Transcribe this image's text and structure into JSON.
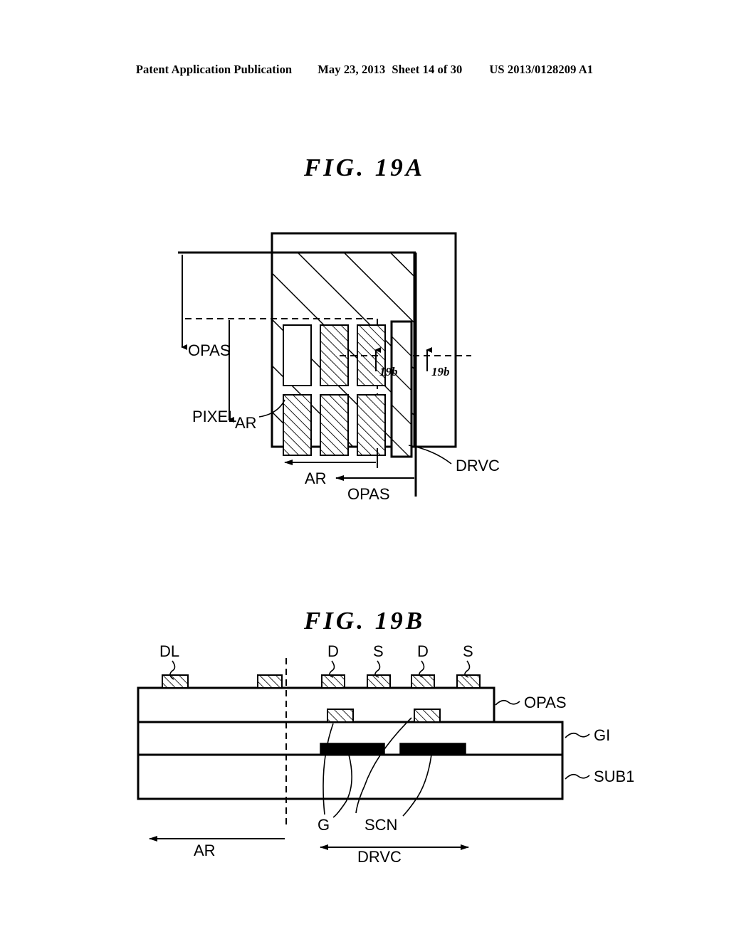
{
  "page": {
    "background": "#ffffff",
    "ink": "#000000"
  },
  "header": {
    "publication": "Patent Application Publication",
    "date": "May 23, 2013",
    "sheet": "Sheet 14 of 30",
    "document_number": "US 2013/0128209 A1"
  },
  "figures": [
    {
      "id": "fig19a",
      "title": "FIG. 19A",
      "kind": "plan-view",
      "labels": {
        "opas_top": "OPAS",
        "ar_top": "AR",
        "pixel": "PIXEL",
        "drvc": "DRVC",
        "ar_bottom": "AR",
        "opas_bottom": "OPAS",
        "section_left": "19b",
        "section_right": "19b"
      },
      "pixel_grid": {
        "columns": 3,
        "rows": 2,
        "count": 6
      }
    },
    {
      "id": "fig19b",
      "title": "FIG. 19B",
      "kind": "cross-section",
      "labels": {
        "dl": "DL",
        "electrodes": [
          "D",
          "S",
          "D",
          "S"
        ],
        "opas": "OPAS",
        "gi": "GI",
        "sub1": "SUB1",
        "g": "G",
        "scn": "SCN",
        "ar": "AR",
        "drvc": "DRVC"
      }
    }
  ]
}
